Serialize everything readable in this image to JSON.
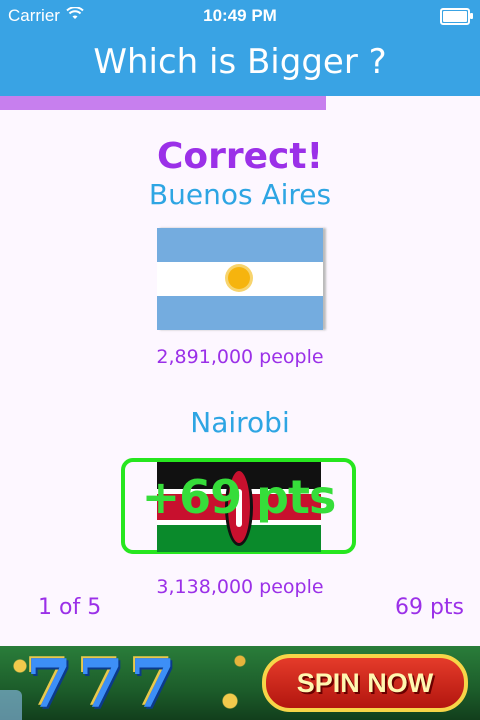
{
  "status": {
    "carrier": "Carrier",
    "time": "10:49 PM"
  },
  "header": {
    "title": "Which is Bigger ?"
  },
  "progress": {
    "value": 0.68
  },
  "result": {
    "label": "Correct!"
  },
  "cities": [
    {
      "name": "Buenos Aires",
      "population": "2,891,000 people",
      "flag": "argentina-flag"
    },
    {
      "name": "Nairobi",
      "population": "3,138,000 people",
      "flag": "kenya-flag"
    }
  ],
  "award": {
    "text": "+69 pts"
  },
  "footer": {
    "round": "1 of 5",
    "score": "69 pts"
  },
  "ad": {
    "sevens": "777",
    "cta": "SPIN NOW"
  },
  "colors": {
    "accent": "#39a3e4",
    "purple": "#9b30e8",
    "green": "#27e61f"
  }
}
